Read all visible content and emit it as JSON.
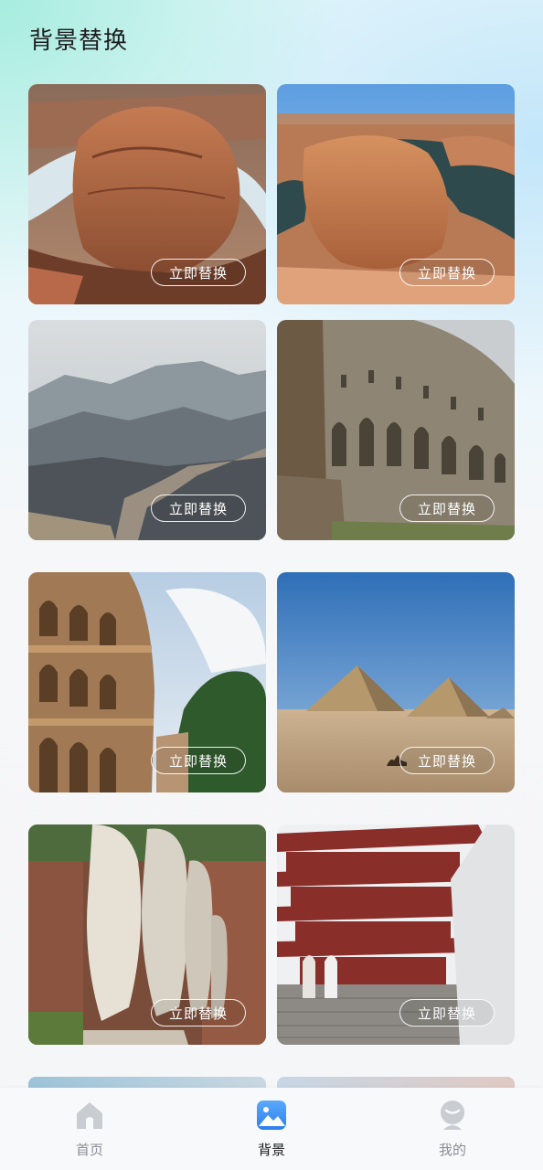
{
  "header": {
    "title": "背景替换"
  },
  "cards": [
    {
      "button_label": "立即替换",
      "subject": "horseshoe-bend-canyon"
    },
    {
      "button_label": "立即替换",
      "subject": "horseshoe-bend-canyon-wide"
    },
    {
      "button_label": "立即替换",
      "subject": "great-wall-mountains"
    },
    {
      "button_label": "立即替换",
      "subject": "roman-amphitheater-ruins"
    },
    {
      "button_label": "立即替换",
      "subject": "colosseum"
    },
    {
      "button_label": "立即替换",
      "subject": "pyramids-desert"
    },
    {
      "button_label": "立即替换",
      "subject": "marble-statues-ruins"
    },
    {
      "button_label": "立即替换",
      "subject": "chinese-pagoda-steps"
    }
  ],
  "tabbar": {
    "items": [
      {
        "label": "首页",
        "icon": "home-icon",
        "active": false
      },
      {
        "label": "背景",
        "icon": "image-icon",
        "active": true
      },
      {
        "label": "我的",
        "icon": "profile-icon",
        "active": false
      }
    ],
    "active_color": "#3d8ff5",
    "inactive_color": "#c9ccd1"
  }
}
